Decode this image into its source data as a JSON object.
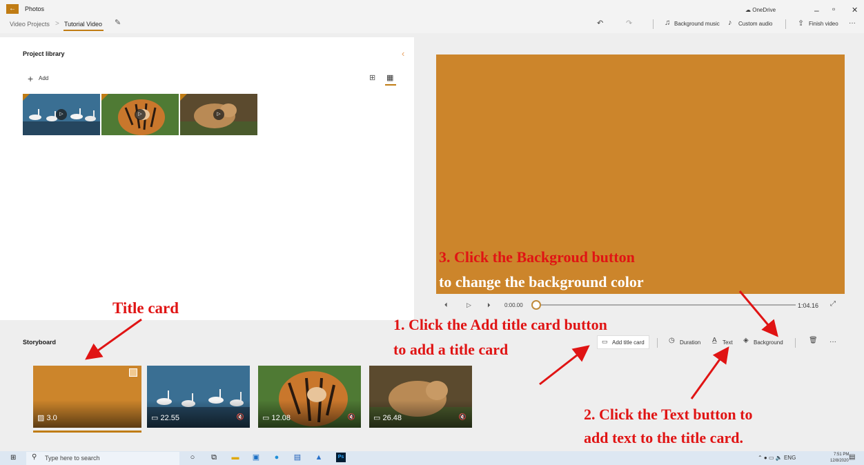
{
  "titlebar": {
    "app_name": "Photos",
    "breadcrumb_parent": "Video Projects",
    "breadcrumb_current": "Tutorial Video",
    "onedrive": "OneDrive",
    "undo": "↶",
    "redo": "↷",
    "background_music": "Background music",
    "custom_audio": "Custom audio",
    "finish_video": "Finish video",
    "more": "···",
    "minimize": "–",
    "maximize": "▫",
    "close": "✕"
  },
  "library": {
    "title": "Project library",
    "add_label": "Add",
    "clips": [
      "swans",
      "tiger",
      "wolf"
    ]
  },
  "preview": {
    "bg_color": "#cc852b",
    "current_time": "0:00.00",
    "total_time": "1:04.16"
  },
  "storyboard": {
    "title": "Storyboard",
    "add_title_card": "Add title card",
    "duration": "Duration",
    "text": "Text",
    "background": "Background",
    "clips": [
      {
        "duration": "3.0",
        "muted": false
      },
      {
        "duration": "22.55",
        "muted": true
      },
      {
        "duration": "12.08",
        "muted": true
      },
      {
        "duration": "26.48",
        "muted": true
      }
    ]
  },
  "annotations": {
    "title_card": "Title card",
    "step1_line1": "1. Click the Add title card button",
    "step1_line2": "to add a title card",
    "step2_line1": "2. Click the Text button to",
    "step2_line2": "add text to the title card.",
    "step3_line1": "3. Click the Backgroud button",
    "step3_line2": "to change the background color",
    "color": "#e01414"
  },
  "taskbar": {
    "search_placeholder": "Type here to search",
    "language": "ENG",
    "time": "7:51 PM",
    "date": "12/8/2020"
  }
}
